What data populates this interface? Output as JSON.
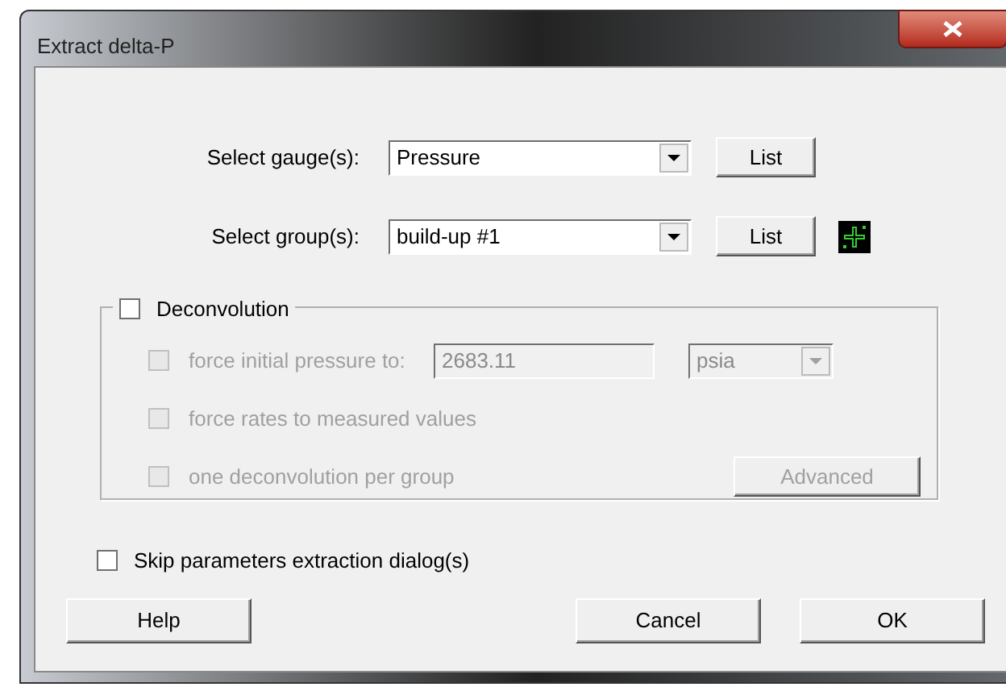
{
  "window": {
    "title": "Extract delta-P"
  },
  "gauge": {
    "label": "Select gauge(s):",
    "value": "Pressure",
    "button": "List"
  },
  "group": {
    "label": "Select group(s):",
    "value": "build-up #1",
    "button": "List"
  },
  "deconvolution": {
    "label": "Deconvolution",
    "checked": false,
    "options": [
      {
        "kind": "value",
        "label": "force initial pressure to:",
        "checked": false,
        "disabled": true,
        "value": "2683.11",
        "unit": "psia"
      },
      {
        "kind": "plain",
        "label": "force rates to measured values",
        "checked": false,
        "disabled": true
      },
      {
        "kind": "button",
        "label": "one deconvolution per group",
        "checked": false,
        "disabled": true,
        "button": "Advanced"
      }
    ]
  },
  "skip": {
    "label": "Skip parameters extraction dialog(s)",
    "checked": false
  },
  "buttons": [
    "Help",
    "Cancel",
    "OK"
  ]
}
